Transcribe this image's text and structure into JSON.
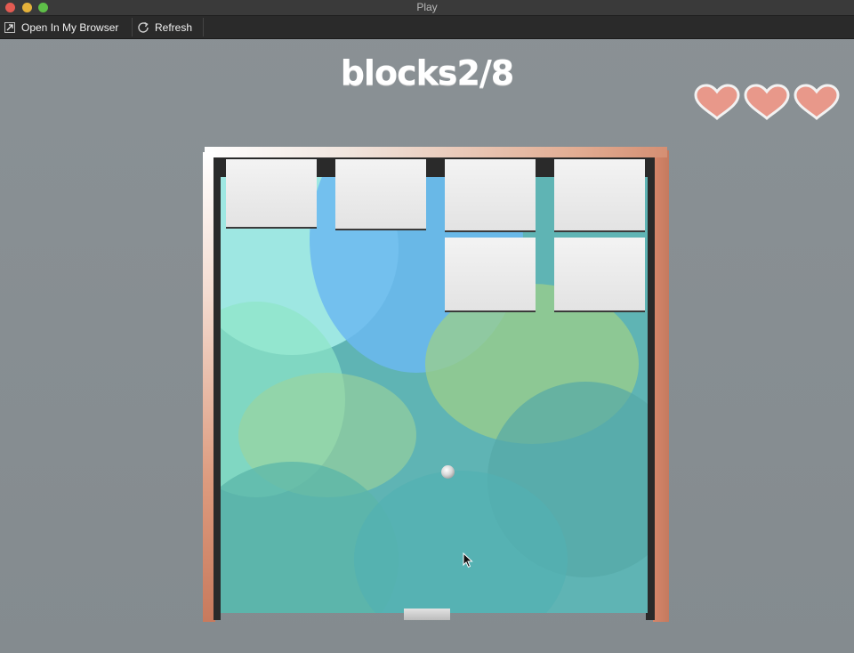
{
  "window": {
    "title": "Play",
    "controls": [
      "close",
      "minimize",
      "maximize"
    ]
  },
  "toolbar": {
    "open_in_browser_label": "Open In My Browser",
    "refresh_label": "Refresh",
    "open_icon": "open-external-icon",
    "refresh_icon": "refresh-icon"
  },
  "game": {
    "title": "blocks2/8",
    "lives": 3,
    "lives_icon": "heart-icon",
    "heart_color": "#e8988a",
    "frame_color": "#d58f73",
    "brick_count_visible": 6,
    "ball": "ball",
    "paddle": "paddle"
  }
}
